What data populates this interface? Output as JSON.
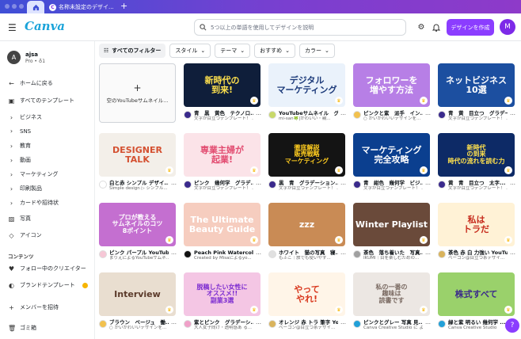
{
  "tabs": {
    "doc_title": "名称未設定のデザイ..."
  },
  "header": {
    "logo": "Canva",
    "search_placeholder": "5つ以上の単語を使用してデザインを説明",
    "create_label": "デザインを作成",
    "avatar_initial": "M"
  },
  "account": {
    "initial": "A",
    "name": "ajsa",
    "plan": "Pro • ♁1"
  },
  "sidebar": {
    "back": "ホームに戻る",
    "all_templates": "すべてのテンプレート",
    "categories": [
      "ビジネス",
      "SNS",
      "教育",
      "動画",
      "マーケティング",
      "印刷製品",
      "カードや招待状"
    ],
    "photos": "写真",
    "icons": "アイコン",
    "content_header": "コンテンツ",
    "following": "フォロー中のクリエイター",
    "brand": "ブランドテンプレート",
    "invite": "メンバーを招待",
    "trash": "ゴミ箱"
  },
  "filters": {
    "all": "すべてのフィルター",
    "items": [
      "スタイル",
      "テーマ",
      "おすすめ",
      "カラー"
    ]
  },
  "blank_card": {
    "label": "空のYouTubeサムネイル..."
  },
  "cards": [
    {
      "title": "青　黒　黄色　テクノロ...",
      "subtitle": "文字が目立つテンプレート！ ...",
      "thumb_text": "新時代の\n到来!",
      "bg": "#0f1e3a",
      "fg": "#ffe14d",
      "creator_bg": "#3a2a8c"
    },
    {
      "title": "YouTubeサムネイル　グ...",
      "subtitle": "mi-san🍀|かわいい・親...",
      "thumb_text": "デジタル\nマーケティング",
      "bg": "#eaf2fb",
      "fg": "#1c3a7a",
      "creator_bg": "#c8d96a"
    },
    {
      "title": "ピンクと紫　派手　イン...",
      "subtitle": "○ かいかわいいデザインを...",
      "thumb_text": "フォロワーを\n増やす方法",
      "bg": "#b77fe6",
      "fg": "#ffffff",
      "creator_bg": "#f2c14e"
    },
    {
      "title": "青　黄　目立つ　グラデーシ...",
      "subtitle": "文字が目立つテンプレート！ ...",
      "thumb_text": "ネットビジネス\n10選",
      "bg": "#1c4fa0",
      "fg": "#ffffff",
      "creator_bg": "#3a2a8c"
    },
    {
      "title": "白と赤 シンプル デザイ...",
      "subtitle": "Simple design ▷ シンプル...",
      "thumb_text": "DESIGNER\nTALK",
      "bg": "#f3efe9",
      "fg": "#d45030",
      "creator_bg": "#ffffff"
    },
    {
      "title": "ピンク　幾何学　グラデ...",
      "subtitle": "文字が目立つテンプレート！ ...",
      "thumb_text": "専業主婦が\n起業!",
      "bg": "#fbe3e8",
      "fg": "#e24a6f",
      "creator_bg": "#3a2a8c"
    },
    {
      "title": "黒　青　グラデーション...",
      "subtitle": "文字が目立つテンプレート！ ...",
      "thumb_text": "徹底解説\n販売戦略\nマーケティング",
      "bg": "#141414",
      "fg": "#ffcc1f",
      "creator_bg": "#3a2a8c"
    },
    {
      "title": "青　紺色　幾何学　ビジ...",
      "subtitle": "文字が目立つテンプレート！ ...",
      "thumb_text": "マーケティング\n完全攻略",
      "bg": "#0b3f8f",
      "fg": "#ffffff",
      "creator_bg": "#3a2a8c"
    },
    {
      "title": "黄　青　目立つ　太字...",
      "subtitle": "文字が目立つテンプレート！ ...",
      "thumb_text": "新時代\nの到来\n時代の流れを読む力",
      "bg": "#0d2a66",
      "fg": "#ffe14d",
      "creator_bg": "#3a2a8c"
    },
    {
      "title": "ピンク パープル YouTub...",
      "subtitle": "まりえによるYouTubeサムネ...",
      "thumb_text": "プロが教える\nサムネイルのコツ\n8ポイント",
      "bg": "#c46fd0",
      "fg": "#ffffff",
      "creator_bg": "#f6c7d6"
    },
    {
      "title": "Peach Pink Watercolor ...",
      "subtitle": "Created by Misaによるyo...",
      "thumb_text": "The Ultimate\nBeauty Guide",
      "bg": "#f6cdbf",
      "fg": "#ffffff",
      "creator_bg": "#111111"
    },
    {
      "title": "ホワイト　猫の写真　寝...",
      "subtitle": "もふこ｜旅でも使いやす...",
      "thumb_text": "zzz",
      "bg": "#c98b55",
      "fg": "#ffffff",
      "creator_bg": "#e0e0e0"
    },
    {
      "title": "茶色　落ち着いた　写真...",
      "subtitle": "IKUMI｜目を楽しむための...",
      "thumb_text": "Winter Playlist",
      "bg": "#6a4a3a",
      "fg": "#ffffff",
      "creator_bg": "#a0a0a0"
    },
    {
      "title": "茶色 赤 白 力強い YouTu...",
      "subtitle": "ベーコン@目立つ系デザイ...",
      "thumb_text": "私は\nトラだ",
      "bg": "#fff2d6",
      "fg": "#c62a1b",
      "creator_bg": "#d9b35c"
    },
    {
      "title": "ブラウン　ベージュ　働...",
      "subtitle": "○ かいかわいいデザインを...",
      "thumb_text": "Interview",
      "bg": "#e9ded0",
      "fg": "#5b3a2a",
      "creator_bg": "#f2c14e"
    },
    {
      "title": "紫とピンク　グラデーシ...",
      "subtitle": "大人女子向け・透明感あ る...",
      "thumb_text": "脱稿したい女性に\nオススメ!!\n副業3選",
      "bg": "#f4c6e4",
      "fg": "#7b2bd0",
      "creator_bg": "#f0a0c8"
    },
    {
      "title": "オレンジ 赤 トラ 筆字 Yo...",
      "subtitle": "ベーコン@目立つ系デザイ...",
      "thumb_text": "やって\nやれ!",
      "bg": "#fff5e8",
      "fg": "#d9381e",
      "creator_bg": "#d9b35c"
    },
    {
      "title": "ピンクとグレー 写真 見...",
      "subtitle": "Canva Creative Studio に よ...",
      "thumb_text": "私の一番の\n趣味は\n読書です",
      "bg": "#ece7e3",
      "fg": "#7a6a62",
      "creator_bg": "#22a0d8"
    },
    {
      "title": "緑と紫 明るい 幾何学 ...",
      "subtitle": "Canva Creative Studio",
      "thumb_text": "株式すべて",
      "bg": "#9ad16b",
      "fg": "#3b2b8a",
      "creator_bg": "#22a0d8"
    }
  ],
  "help_label": "?"
}
